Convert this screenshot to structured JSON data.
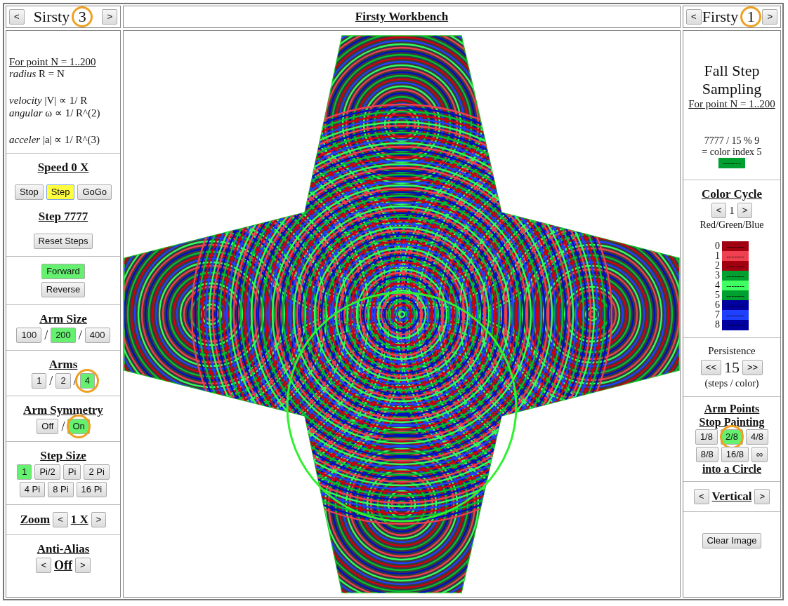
{
  "left_header": {
    "prev": "<",
    "title": "Sirsty",
    "number": "3",
    "next": ">",
    "circled": true
  },
  "center_title": "Firsty Workbench",
  "right_header": {
    "prev": "<",
    "title": "Firsty",
    "number": "1",
    "next": ">",
    "circled": true
  },
  "left": {
    "formula_heading": "For point N = 1..200",
    "formula_groups": [
      [
        "*radius* R = N"
      ],
      [
        "*velocity* |V| ∝ 1/ R",
        "*angular* ω ∝ 1/ R^(2)"
      ],
      [
        "*acceler* |a| ∝ 1/ R^(3)"
      ]
    ],
    "speed": "Speed 0 X",
    "run_buttons": [
      {
        "label": "Stop",
        "selected": false
      },
      {
        "label": "Step",
        "selected": true
      },
      {
        "label": "GoGo",
        "selected": false
      }
    ],
    "step": "Step 7777",
    "reset": "Reset Steps",
    "direction": [
      {
        "label": "Forward",
        "selected": true
      },
      {
        "label": "Reverse",
        "selected": false
      }
    ],
    "choice_groups": [
      {
        "title": "Arm Size",
        "separator": "/",
        "options": [
          {
            "label": "100",
            "selected": false,
            "circled": false
          },
          {
            "label": "200",
            "selected": true,
            "circled": false
          },
          {
            "label": "400",
            "selected": false,
            "circled": false
          }
        ]
      },
      {
        "title": "Arms",
        "separator": "/",
        "options": [
          {
            "label": "1",
            "selected": false,
            "circled": false
          },
          {
            "label": "2",
            "selected": false,
            "circled": false
          },
          {
            "label": "4",
            "selected": true,
            "circled": true
          }
        ]
      },
      {
        "title": "Arm Symmetry",
        "separator": "/",
        "options": [
          {
            "label": "Off",
            "selected": false,
            "circled": false
          },
          {
            "label": "On",
            "selected": true,
            "circled": true
          }
        ]
      }
    ],
    "step_size": {
      "title": "Step Size",
      "options": [
        {
          "label": "1",
          "selected": true
        },
        {
          "label": "Pi/2",
          "selected": false
        },
        {
          "label": "Pi",
          "selected": false
        },
        {
          "label": "2 Pi",
          "selected": false
        },
        {
          "label": "4 Pi",
          "selected": false
        },
        {
          "label": "8 Pi",
          "selected": false
        },
        {
          "label": "16 Pi",
          "selected": false
        }
      ]
    },
    "zoom": {
      "title": "Zoom",
      "prev": "<",
      "value": "1 X",
      "next": ">"
    },
    "anti_alias": {
      "title": "Anti-Alias",
      "prev": "<",
      "value": "Off",
      "next": ">"
    }
  },
  "right": {
    "title_lines": [
      "Fall Step",
      "Sampling"
    ],
    "formula_heading": "For point N = 1..200",
    "calc": "7777 / 15 % 9",
    "result": "= color index 5",
    "result_swatch": {
      "color": "#00a030",
      "text": "-------"
    },
    "color_cycle": {
      "title": "Color Cycle",
      "prev": "<",
      "value": "1",
      "next": ">",
      "name": "Red/Green/Blue"
    },
    "legend": [
      {
        "index": "0",
        "color": "#a00010",
        "text": "-------"
      },
      {
        "index": "1",
        "color": "#f04050",
        "text": "-------"
      },
      {
        "index": "2",
        "color": "#a00010",
        "text": "-------"
      },
      {
        "index": "3",
        "color": "#00a030",
        "text": "-------"
      },
      {
        "index": "4",
        "color": "#40ff60",
        "text": "-------"
      },
      {
        "index": "5",
        "color": "#00a030",
        "text": "-------"
      },
      {
        "index": "6",
        "color": "#0000a0",
        "text": "-------"
      },
      {
        "index": "7",
        "color": "#2040ff",
        "text": "-------"
      },
      {
        "index": "8",
        "color": "#0000a0",
        "text": "-------"
      }
    ],
    "persistence": {
      "title": "Persistence",
      "prev": "<<",
      "value": "15",
      "next": ">>",
      "unit": "(steps / color)"
    },
    "arm_points": {
      "title_lines": [
        "Arm Points",
        "Stop Painting"
      ],
      "options": [
        {
          "label": "1/8",
          "selected": false,
          "circled": false
        },
        {
          "label": "2/8",
          "selected": true,
          "circled": true
        },
        {
          "label": "4/8",
          "selected": false,
          "circled": false
        },
        {
          "label": "8/8",
          "selected": false,
          "circled": false
        },
        {
          "label": "16/8",
          "selected": false,
          "circled": false
        },
        {
          "label": "∞",
          "selected": false,
          "circled": false
        }
      ],
      "footer": "into a Circle"
    },
    "orientation": {
      "prev": "<",
      "value": "Vertical",
      "next": ">"
    },
    "clear": "Clear Image"
  }
}
